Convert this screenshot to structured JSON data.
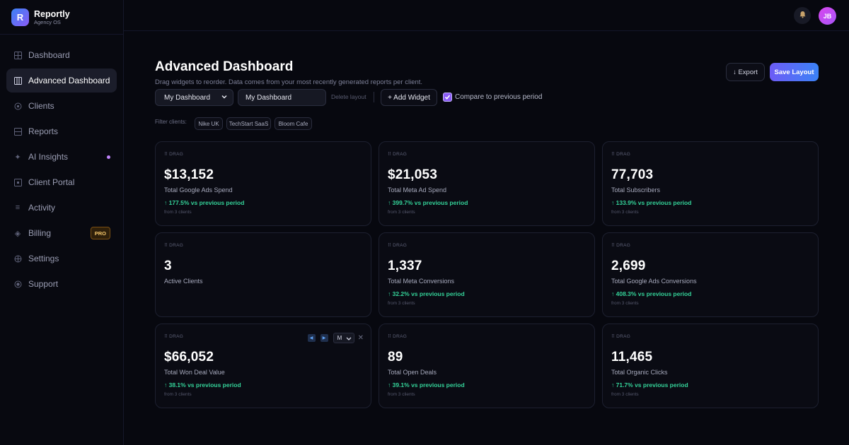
{
  "brand": {
    "logo_letter": "R",
    "name": "Reportly",
    "subtitle": "Agency OS"
  },
  "sidebar": {
    "items": [
      {
        "label": "Dashboard",
        "icon": "grid-icon",
        "active": false
      },
      {
        "label": "Advanced Dashboard",
        "icon": "columns-icon",
        "active": true
      },
      {
        "label": "Clients",
        "icon": "users-icon",
        "active": false
      },
      {
        "label": "Reports",
        "icon": "file-icon",
        "active": false
      },
      {
        "label": "AI Insights",
        "icon": "sparkle-icon",
        "active": false,
        "dot": true
      },
      {
        "label": "Client Portal",
        "icon": "portal-icon",
        "active": false
      },
      {
        "label": "Activity",
        "icon": "list-icon",
        "active": false
      },
      {
        "label": "Billing",
        "icon": "diamond-icon",
        "active": false,
        "badge": "PRO"
      },
      {
        "label": "Settings",
        "icon": "gear-icon",
        "active": false
      },
      {
        "label": "Support",
        "icon": "help-icon",
        "active": false
      }
    ]
  },
  "topbar": {
    "avatar_initials": "JB"
  },
  "header": {
    "title": "Advanced Dashboard",
    "subtitle": "Drag widgets to reorder. Data comes from your most recently generated reports per client.",
    "export_label": "↓ Export",
    "save_label": "Save Layout"
  },
  "controls": {
    "dashboard_select_value": "My Dashboard",
    "dashboard_name_value": "My Dashboard",
    "delete_label": "Delete layout",
    "add_widget_label": "+ Add Widget",
    "compare_label": "Compare to previous period",
    "compare_checked": true
  },
  "filter": {
    "label": "Filter clients:",
    "clients": [
      "Nike UK",
      "TechStart SaaS",
      "Bloom Cafe"
    ]
  },
  "widgets": [
    {
      "drag": "⠿ DRAG",
      "value": "$13,152",
      "label": "Total Google Ads Spend",
      "change": "↑ 177.5% vs previous period",
      "sub": "from 3 clients"
    },
    {
      "drag": "⠿ DRAG",
      "value": "$21,053",
      "label": "Total Meta Ad Spend",
      "change": "↑ 399.7% vs previous period",
      "sub": "from 3 clients"
    },
    {
      "drag": "⠿ DRAG",
      "value": "77,703",
      "label": "Total Subscribers",
      "change": "↑ 133.9% vs previous period",
      "sub": "from 3 clients"
    },
    {
      "drag": "⠿ DRAG",
      "value": "3",
      "label": "Active Clients",
      "change": "",
      "sub": ""
    },
    {
      "drag": "⠿ DRAG",
      "value": "1,337",
      "label": "Total Meta Conversions",
      "change": "↑ 32.2% vs previous period",
      "sub": "from 3 clients"
    },
    {
      "drag": "⠿ DRAG",
      "value": "2,699",
      "label": "Total Google Ads Conversions",
      "change": "↑ 408.3% vs previous period",
      "sub": "from 3 clients"
    },
    {
      "drag": "⠿ DRAG",
      "value": "$66,052",
      "label": "Total Won Deal Value",
      "change": "↑ 38.1% vs previous period",
      "sub": "from 3 clients",
      "size_option": "M"
    },
    {
      "drag": "⠿ DRAG",
      "value": "89",
      "label": "Total Open Deals",
      "change": "↑ 39.1% vs previous period",
      "sub": "from 3 clients"
    },
    {
      "drag": "⠿ DRAG",
      "value": "11,465",
      "label": "Total Organic Clicks",
      "change": "↑ 71.7% vs previous period",
      "sub": "from 3 clients"
    }
  ],
  "colors": {
    "background": "#07080f",
    "accent_gradient_start": "#6d5cf6",
    "accent_gradient_end": "#3b82f6",
    "positive": "#34d399"
  }
}
